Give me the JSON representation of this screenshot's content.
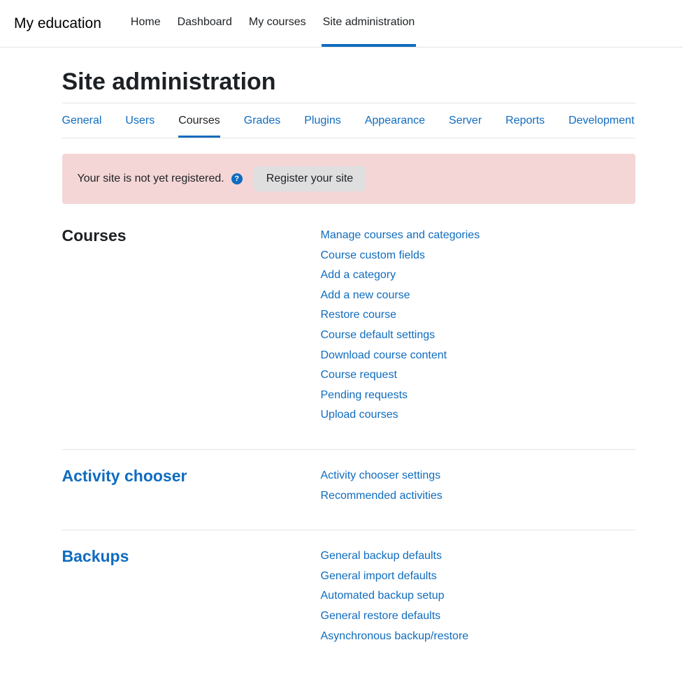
{
  "brand": "My education",
  "topnav": {
    "items": [
      {
        "label": "Home",
        "active": false
      },
      {
        "label": "Dashboard",
        "active": false
      },
      {
        "label": "My courses",
        "active": false
      },
      {
        "label": "Site administration",
        "active": true
      }
    ]
  },
  "page": {
    "title": "Site administration"
  },
  "tabs": [
    {
      "label": "General",
      "active": false
    },
    {
      "label": "Users",
      "active": false
    },
    {
      "label": "Courses",
      "active": true
    },
    {
      "label": "Grades",
      "active": false
    },
    {
      "label": "Plugins",
      "active": false
    },
    {
      "label": "Appearance",
      "active": false
    },
    {
      "label": "Server",
      "active": false
    },
    {
      "label": "Reports",
      "active": false
    },
    {
      "label": "Development",
      "active": false
    }
  ],
  "alert": {
    "text": "Your site is not yet registered.",
    "help_glyph": "?",
    "button": "Register your site"
  },
  "sections": [
    {
      "title": "Courses",
      "title_is_link": false,
      "links": [
        "Manage courses and categories",
        "Course custom fields",
        "Add a category",
        "Add a new course",
        "Restore course",
        "Course default settings",
        "Download course content",
        "Course request",
        "Pending requests",
        "Upload courses"
      ]
    },
    {
      "title": "Activity chooser",
      "title_is_link": true,
      "links": [
        "Activity chooser settings",
        "Recommended activities"
      ]
    },
    {
      "title": "Backups",
      "title_is_link": true,
      "links": [
        "General backup defaults",
        "General import defaults",
        "Automated backup setup",
        "General restore defaults",
        "Asynchronous backup/restore"
      ]
    }
  ]
}
